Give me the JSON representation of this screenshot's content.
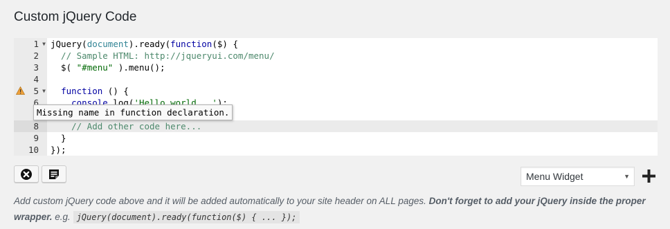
{
  "title": "Custom jQuery Code",
  "editor": {
    "line_numbers": [
      "1",
      "2",
      "3",
      "4",
      "5",
      "6",
      "8",
      "9",
      "10"
    ],
    "lines": {
      "l1_a": "jQuery(",
      "l1_b": "document",
      "l1_c": ").ready(",
      "l1_d": "function",
      "l1_e": "($) {",
      "l2": "  // Sample HTML: http://jqueryui.com/menu/",
      "l3_a": "  $( ",
      "l3_b": "\"#menu\"",
      "l3_c": " ).menu();",
      "l4": "",
      "l5_a": "  ",
      "l5_b": "function",
      "l5_c": " () {",
      "l6_a": "    ",
      "l6_b": "console",
      "l6_c": ".log(",
      "l6_d": "'Hello world...'",
      "l6_e": ");",
      "l8": "    // Add other code here...",
      "l9": "  }",
      "l10": "});"
    },
    "tooltip": "Missing name in function declaration.",
    "warning_icon": "warning-triangle-icon"
  },
  "toolbar": {
    "clear_icon": "close-circle-icon",
    "snippet_icon": "notes-icon",
    "select_value": "Menu Widget",
    "add_icon": "plus-icon"
  },
  "help": {
    "text_plain": "Add custom jQuery code above and it will be added automatically to your site header on ALL pages. ",
    "text_bold": "Don't forget to add your jQuery inside the proper wrapper.",
    "text_eg": " e.g. ",
    "code_sample": "jQuery(document).ready(function($) { ... });"
  },
  "colors": {
    "keyword": "#0000a2",
    "comment": "#4c886b",
    "string": "#036a07",
    "warning": "#f0a13a"
  }
}
